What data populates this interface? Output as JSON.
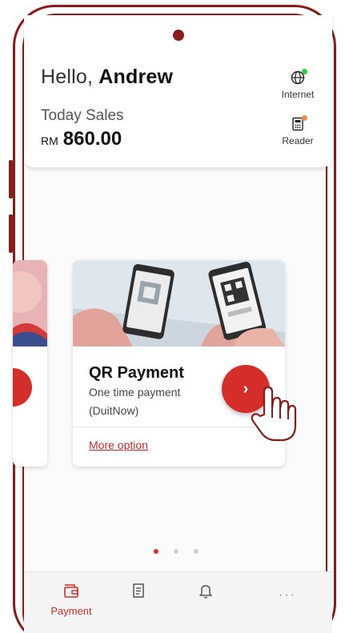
{
  "header": {
    "greeting_prefix": "Hello, ",
    "user_name": "Andrew",
    "sales_label": "Today Sales",
    "currency": "RM",
    "sales_amount": "860.00"
  },
  "status": {
    "internet_label": "Internet",
    "internet_icon": "globe-icon",
    "internet_color": "#2ecc40",
    "reader_label": "Reader",
    "reader_icon": "card-reader-icon",
    "reader_color": "#f08a4b"
  },
  "carousel": {
    "active_index": 1,
    "card": {
      "title": "QR Payment",
      "subtitle": "One time payment",
      "subtitle2": "(DuitNow)",
      "more_link": "More option",
      "go_icon": "chevron-right-icon",
      "go_label": "›"
    }
  },
  "bottom_nav": {
    "items": [
      {
        "label": "Payment",
        "icon": "wallet-icon",
        "active": true
      },
      {
        "label": "",
        "icon": "receipt-icon",
        "active": false
      },
      {
        "label": "",
        "icon": "bell-icon",
        "active": false
      },
      {
        "label": "···",
        "icon": "more-icon",
        "active": false
      }
    ]
  },
  "colors": {
    "accent": "#d42d2a",
    "frame": "#8a1c1c"
  }
}
